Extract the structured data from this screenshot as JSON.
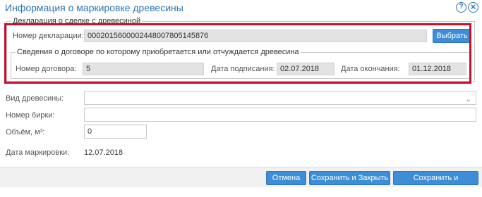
{
  "window": {
    "title": "Информация о маркировке древесины",
    "help_icon": "?",
    "close_icon": "×"
  },
  "declaration": {
    "legend": "Декларация о сделке с древесиной",
    "number_label": "Номер декларации:",
    "number_value": "0002015600002448007805145876",
    "select_button": "Выбрать",
    "contract": {
      "legend": "Сведения о договоре по которому приобретается или отчуждается древесина",
      "number_label": "Номер договора:",
      "number_value": "5",
      "sign_date_label": "Дата подписания:",
      "sign_date_value": "02.07.2018",
      "end_date_label": "Дата окончания:",
      "end_date_value": "01.12.2018"
    }
  },
  "form": {
    "wood_type_label": "Вид древесины:",
    "wood_type_value": "",
    "tag_number_label": "Номер бирки:",
    "tag_number_value": "",
    "volume_label": "Объём, м³:",
    "volume_value": "0",
    "marking_date_label": "Дата маркировки:",
    "marking_date_value": "12.07.2018"
  },
  "footer": {
    "cancel": "Отмена",
    "save_close": "Сохранить и Закрыть",
    "save_sign": "Сохранить и Подписать"
  },
  "colors": {
    "accent": "#3d8ed6",
    "title": "#2e74b5",
    "highlight": "#c8102e"
  }
}
